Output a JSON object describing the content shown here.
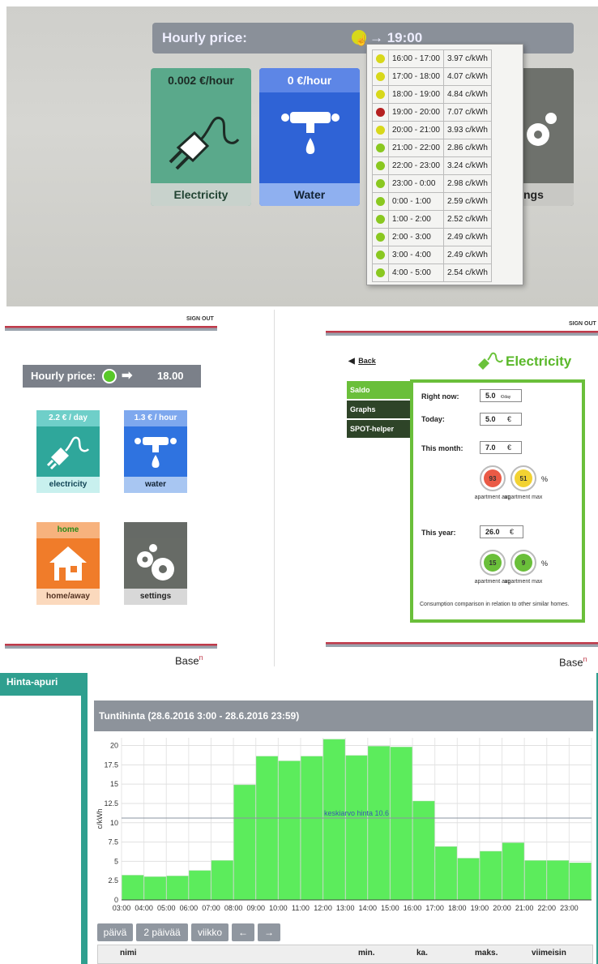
{
  "kiosk": {
    "hourly_label": "Hourly price:",
    "time_arrow": "→ 19:00",
    "tiles": [
      {
        "price": "0.002 €/hour",
        "label": "Electricity",
        "color": "#5aa98b"
      },
      {
        "price": "0 €/hour",
        "label": "Water",
        "color": "#2f63d6"
      }
    ],
    "settings_fragment": "ngs",
    "price_rows": [
      {
        "range": "16:00 - 17:00",
        "price": "3.97 c/kWh",
        "color": "#d8d81a"
      },
      {
        "range": "17:00 - 18:00",
        "price": "4.07 c/kWh",
        "color": "#d8d81a"
      },
      {
        "range": "18:00 - 19:00",
        "price": "4.84 c/kWh",
        "color": "#d8d81a"
      },
      {
        "range": "19:00 - 20:00",
        "price": "7.07 c/kWh",
        "color": "#b52020"
      },
      {
        "range": "20:00 - 21:00",
        "price": "3.93 c/kWh",
        "color": "#d8d81a"
      },
      {
        "range": "21:00 - 22:00",
        "price": "2.86 c/kWh",
        "color": "#8ac820"
      },
      {
        "range": "22:00 - 23:00",
        "price": "3.24 c/kWh",
        "color": "#8ac820"
      },
      {
        "range": "23:00 - 0:00",
        "price": "2.98 c/kWh",
        "color": "#8ac820"
      },
      {
        "range": "0:00 - 1:00",
        "price": "2.59 c/kWh",
        "color": "#8ac820"
      },
      {
        "range": "1:00 - 2:00",
        "price": "2.52 c/kWh",
        "color": "#8ac820"
      },
      {
        "range": "2:00 - 3:00",
        "price": "2.49 c/kWh",
        "color": "#8ac820"
      },
      {
        "range": "3:00 - 4:00",
        "price": "2.49 c/kWh",
        "color": "#8ac820"
      },
      {
        "range": "4:00 - 5:00",
        "price": "2.54 c/kWh",
        "color": "#8ac820"
      }
    ]
  },
  "home": {
    "sign_out": "SIGN OUT",
    "hourly_label": "Hourly price:",
    "hourly_value": "18.00",
    "tiles": [
      {
        "top": "2.2 € / day",
        "label": "electricity",
        "top_color": "#6fcfc9",
        "body_color": "#2fa79b",
        "label_bg": "#c8f0ee",
        "icon": "plug-icon"
      },
      {
        "top": "1.3 € / hour",
        "label": "water",
        "top_color": "#7ea8ee",
        "body_color": "#2f73e0",
        "label_bg": "#a8c6f2",
        "icon": "faucet-icon"
      },
      {
        "top": "home",
        "label": "home/away",
        "top_color": "#f7b27d",
        "body_color": "#f07c2a",
        "label_bg": "#fbd9bd",
        "icon": "house-icon"
      },
      {
        "top": "",
        "label": "settings",
        "top_color": "#666a66",
        "body_color": "#676b66",
        "label_bg": "#d8d8d8",
        "icon": "gears-icon"
      }
    ],
    "brand": "Base",
    "brand_sup": "n"
  },
  "electricity": {
    "sign_out": "SIGN OUT",
    "back": "Back",
    "title": "Electricity",
    "menu": [
      "Saldo",
      "Graphs",
      "SPOT-helper"
    ],
    "right_now_label": "Right now:",
    "right_now_value": "5.0",
    "right_now_unit": "€/day",
    "today_label": "Today:",
    "today_value": "5.0",
    "today_unit": "€",
    "month_label": "This month:",
    "month_value": "7.0",
    "month_unit": "€",
    "month_avg": "93",
    "month_max": "51",
    "year_label": "This year:",
    "year_value": "26.0",
    "year_unit": "€",
    "year_avg": "15",
    "year_max": "9",
    "percent": "%",
    "apartment_avg": "apartment avg",
    "apartment_max": "apartment max",
    "note": "Consumption comparison in relation to other similar homes.",
    "brand": "Base",
    "brand_sup": "n"
  },
  "hinta": {
    "tab": "Hinta-apuri",
    "chart_title": "Tuntihinta (28.6.2016 3:00 - 28.6.2016 23:59)",
    "buttons": [
      "päivä",
      "2 päivää",
      "viikko",
      "←",
      "→"
    ],
    "table_headers": [
      "nimi",
      "min.",
      "ka.",
      "maks.",
      "viimeisin"
    ]
  },
  "chart_data": {
    "type": "bar",
    "title": "Tuntihinta (28.6.2016 3:00 - 28.6.2016 23:59)",
    "ylabel": "c/kWh",
    "xlabel": "",
    "ylim": [
      0,
      21
    ],
    "yticks": [
      "0",
      "2.5",
      "5",
      "7.5",
      "10",
      "12.5",
      "15",
      "17.5",
      "20"
    ],
    "categories": [
      "03:00",
      "04:00",
      "05:00",
      "06:00",
      "07:00",
      "08:00",
      "09:00",
      "10:00",
      "11:00",
      "12:00",
      "13:00",
      "14:00",
      "15:00",
      "16:00",
      "17:00",
      "18:00",
      "19:00",
      "20:00",
      "21:00",
      "22:00",
      "23:00"
    ],
    "values": [
      3.2,
      3.0,
      3.1,
      3.8,
      5.1,
      14.9,
      18.6,
      18.0,
      18.6,
      20.8,
      18.7,
      19.9,
      19.8,
      12.8,
      6.9,
      5.4,
      6.3,
      7.4,
      5.1,
      5.1,
      4.8
    ],
    "average": 10.6,
    "average_label": "keskiarvo hinta 10.6",
    "bar_color": "#5cec5c",
    "grid": true
  }
}
